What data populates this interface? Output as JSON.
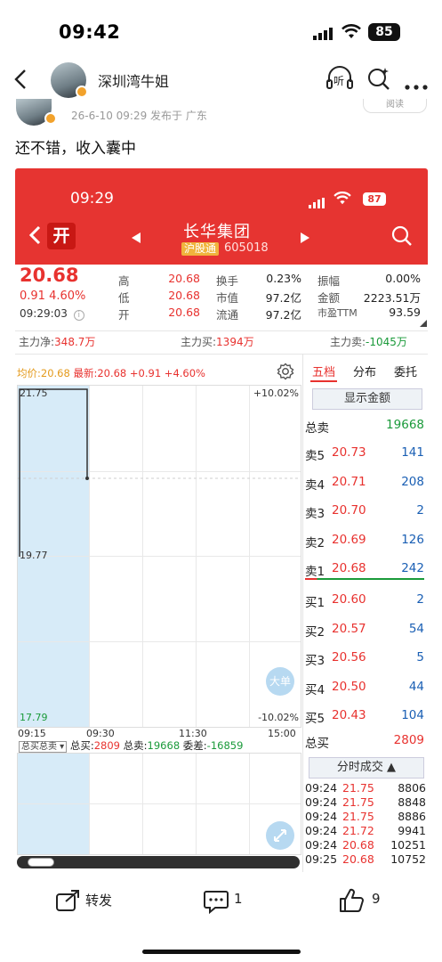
{
  "status_bar": {
    "time": "09:42",
    "battery": "85"
  },
  "post": {
    "author": "深圳湾牛姐",
    "meta": "26-6-10 09:29  发布于 广东",
    "read_label": "阅读",
    "text": "还不错，收入囊中"
  },
  "header_icons": {
    "listen_label": "听"
  },
  "shot": {
    "status_time": "09:29",
    "battery": "87",
    "open_badge": "开",
    "stock_name": "长华集团",
    "exchange_tag": "沪股通",
    "code": "605018",
    "price": "20.68",
    "change": "0.91  4.60%",
    "time": "09:29:03",
    "quote": [
      {
        "label": "高",
        "value": "20.68"
      },
      {
        "label": "低",
        "value": "20.68"
      },
      {
        "label": "开",
        "value": "20.68"
      }
    ],
    "quote_mid": [
      {
        "label": "换手",
        "value": "0.23%"
      },
      {
        "label": "市值",
        "value": "97.2亿"
      },
      {
        "label": "流通",
        "value": "97.2亿"
      }
    ],
    "quote_right": [
      {
        "label": "振幅",
        "value": "0.00%"
      },
      {
        "label": "金额",
        "value": "2223.51万"
      },
      {
        "label": "市盈TTM",
        "value": "93.59"
      }
    ],
    "flow": {
      "net_label": "主力净:",
      "net_value": "348.7万",
      "buy_label": "主力买:",
      "buy_value": "1394万",
      "sell_label": "主力卖:",
      "sell_value": "-1045万"
    },
    "chart_legend": {
      "avg": "均价:20.68",
      "latest": "最新:20.68 +0.91 +4.60%"
    },
    "chart": {
      "y_top": "21.75",
      "y_mid": "19.77",
      "y_bot": "17.79",
      "pct_top": "+10.02%",
      "pct_bot": "-10.02%",
      "x_ticks": [
        "09:15",
        "09:30",
        "11:30",
        "15:00"
      ],
      "big_order": "大单"
    },
    "volume": {
      "selector": "总买总卖 ▾",
      "total_buy_label": "总买:",
      "total_buy": "2809",
      "total_sell_label": "总卖:",
      "total_sell": "19668",
      "diff_label": "委差:",
      "diff": "-16859"
    },
    "tabs": [
      "五档",
      "分布",
      "委托"
    ],
    "show_amount": "显示金额",
    "total_sell_label": "总卖",
    "total_sell_value": "19668",
    "sell_levels": [
      {
        "label": "卖5",
        "price": "20.73",
        "vol": "141"
      },
      {
        "label": "卖4",
        "price": "20.71",
        "vol": "208"
      },
      {
        "label": "卖3",
        "price": "20.70",
        "vol": "2"
      },
      {
        "label": "卖2",
        "price": "20.69",
        "vol": "126"
      },
      {
        "label": "卖1",
        "price": "20.68",
        "vol": "242"
      }
    ],
    "buy_levels": [
      {
        "label": "买1",
        "price": "20.60",
        "vol": "2"
      },
      {
        "label": "买2",
        "price": "20.57",
        "vol": "54"
      },
      {
        "label": "买3",
        "price": "20.56",
        "vol": "5"
      },
      {
        "label": "买4",
        "price": "20.50",
        "vol": "44"
      },
      {
        "label": "买5",
        "price": "20.43",
        "vol": "104"
      }
    ],
    "total_buy_label": "总买",
    "total_buy_value": "2809",
    "trades_title": "分时成交 ▲",
    "trades": [
      {
        "time": "09:24",
        "price": "21.75",
        "vol": "8806"
      },
      {
        "time": "09:24",
        "price": "21.75",
        "vol": "8848"
      },
      {
        "time": "09:24",
        "price": "21.75",
        "vol": "8886"
      },
      {
        "time": "09:24",
        "price": "21.72",
        "vol": "9941"
      },
      {
        "time": "09:24",
        "price": "20.68",
        "vol": "10251"
      },
      {
        "time": "09:25",
        "price": "20.68",
        "vol": "10752"
      }
    ]
  },
  "actions": {
    "share_label": "转发",
    "comment_count": "1",
    "like_count": "9"
  }
}
